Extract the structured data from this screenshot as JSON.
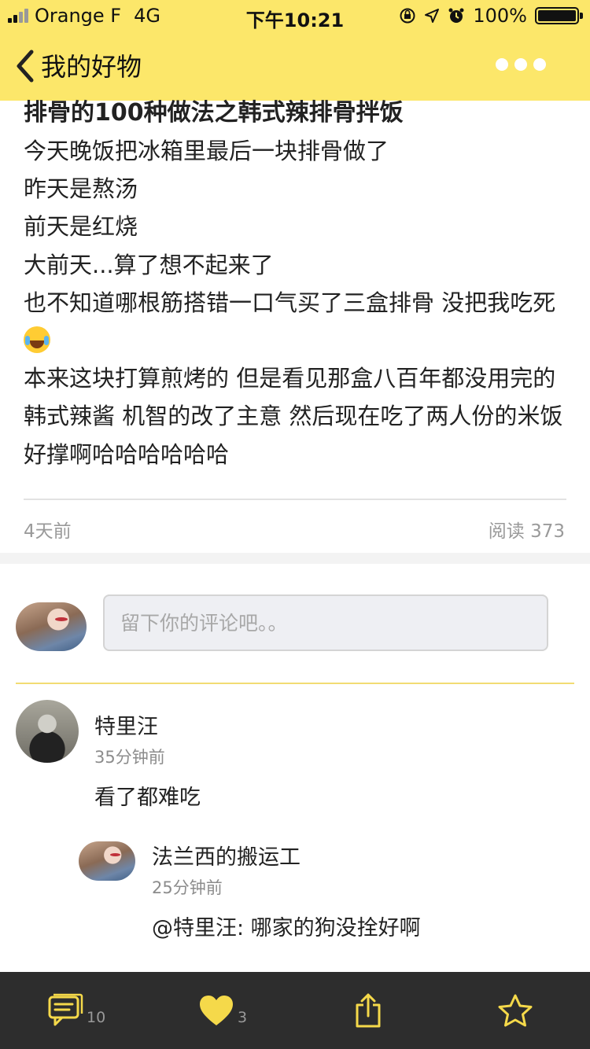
{
  "status_bar": {
    "carrier": "Orange F",
    "network": "4G",
    "time": "下午10:21",
    "battery": "100%",
    "battery_level": 1.0,
    "icons": [
      "signal-icon",
      "orientation-lock-icon",
      "location-arrow-icon",
      "alarm-icon",
      "battery-icon"
    ]
  },
  "nav": {
    "title": "我的好物",
    "back_icon": "chevron-left-icon",
    "more_icon": "more-dots-icon"
  },
  "article": {
    "title": "排骨的100种做法之韩式辣排骨拌饭",
    "lines": [
      "今天晚饭把冰箱里最后一块排骨做了",
      "昨天是熬汤",
      "前天是红烧",
      "大前天...算了想不起来了",
      "也不知道哪根筋搭错一口气买了三盒排骨 没把我吃死",
      "本来这块打算煎烤的 但是看见那盒八百年都没用完的韩式辣酱 机智的改了主意 然后现在吃了两人份的米饭好撑啊哈哈哈哈哈哈"
    ],
    "posted": "4天前",
    "reads": "阅读 373"
  },
  "comment_box": {
    "placeholder": "留下你的评论吧。。"
  },
  "comments": [
    {
      "name": "特里汪",
      "time": "35分钟前",
      "text": "看了都难吃",
      "replies": [
        {
          "name": "法兰西的搬运工",
          "time": "25分钟前",
          "text": "@特里汪: 哪家的狗没拴好啊"
        }
      ]
    }
  ],
  "tabbar": {
    "comment_count": "10",
    "like_count": "3",
    "icons": [
      "comment-icon",
      "heart-icon",
      "share-icon",
      "star-icon"
    ]
  },
  "colors": {
    "brand_yellow": "#fce76a",
    "accent_yellow": "#f5d94a",
    "tabbar_bg": "#2d2d2d",
    "divider_yellow": "#f2dc73"
  }
}
